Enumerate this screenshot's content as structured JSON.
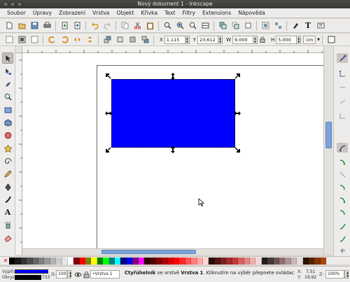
{
  "window": {
    "title": "Nový dokument 1 - Inkscape"
  },
  "menu": [
    "Soubor",
    "Úpravy",
    "Zobrazení",
    "Vrstva",
    "Objekt",
    "Křivka",
    "Text",
    "Filtry",
    "Extensions",
    "Nápověda"
  ],
  "command_bar": {
    "icons": [
      "new-document-icon",
      "open-icon",
      "save-icon",
      "print-icon",
      "import-icon",
      "export-icon",
      "undo-icon",
      "redo-icon",
      "copy-icon",
      "cut-icon",
      "paste-icon",
      "zoom-selection-icon",
      "zoom-drawing-icon",
      "zoom-page-icon",
      "duplicate-icon",
      "clone-icon",
      "unlink-clone-icon",
      "group-icon",
      "ungroup-icon",
      "fill-stroke-icon",
      "text-font-icon",
      "xml-editor-icon"
    ]
  },
  "tool_controls": {
    "x_label": "X",
    "x_value": "1,115",
    "y_label": "Y",
    "y_value": "23,612",
    "w_label": "W",
    "w_value": "9,000",
    "h_label": "H",
    "h_value": "5,000",
    "unit": "cm"
  },
  "toolbox": {
    "tools": [
      "selector-tool-icon",
      "node-tool-icon",
      "tweak-tool-icon",
      "zoom-tool-icon",
      "rectangle-tool-icon",
      "3d-box-tool-icon",
      "ellipse-tool-icon",
      "star-tool-icon",
      "spiral-tool-icon",
      "pencil-tool-icon",
      "pen-tool-icon",
      "calligraphy-tool-icon",
      "text-tool-icon",
      "spray-tool-icon",
      "eraser-tool-icon"
    ],
    "active": "selector-tool-icon"
  },
  "canvas": {
    "object": {
      "type": "rectangle",
      "fill": "#0000ff"
    }
  },
  "palette": {
    "colors": [
      "#000000",
      "#1a1a1a",
      "#333333",
      "#4d4d4d",
      "#666666",
      "#808080",
      "#999999",
      "#b3b3b3",
      "#cccccc",
      "#e6e6e6",
      "#ffffff",
      "#800000",
      "#ff0000",
      "#808000",
      "#ffff00",
      "#008000",
      "#00ff00",
      "#008080",
      "#00ffff",
      "#000080",
      "#0000ff",
      "#800080",
      "#ff00ff",
      "#2b0000",
      "#550000",
      "#800000",
      "#aa0000",
      "#d40000",
      "#ff0000",
      "#ff2a2a",
      "#ff5555",
      "#ff8080",
      "#ffaaaa",
      "#ffd5d5",
      "#280b0b",
      "#501616",
      "#782121",
      "#a02c2c",
      "#c83737",
      "#d35f5f",
      "#de8787",
      "#e9afaf",
      "#f4d7d7",
      "#241c1c",
      "#483737",
      "#6c5353",
      "#916f6f",
      "#ac9393",
      "#c8b7b7",
      "#e3dbdb",
      "#2b1100",
      "#552200",
      "#803300",
      "#aa4400"
    ]
  },
  "status": {
    "fill_label": "Výplň:",
    "stroke_label": "Obrys:",
    "stroke_width": "0,733",
    "opacity_label": "O:",
    "opacity_value": "100",
    "layer": "•Vrstva 1",
    "message_bold1": "Čtyřúhelník",
    "message_mid": " ve vrstvě ",
    "message_bold2": "Vrstva 1",
    "message_tail": ". Kliknutím na výběr přepnete ovládací ...",
    "x_label": "X:",
    "x_value": "7,51",
    "y_label": "Y:",
    "y_value": "19,92",
    "zoom_label": "Z:",
    "zoom_value": "100%"
  }
}
